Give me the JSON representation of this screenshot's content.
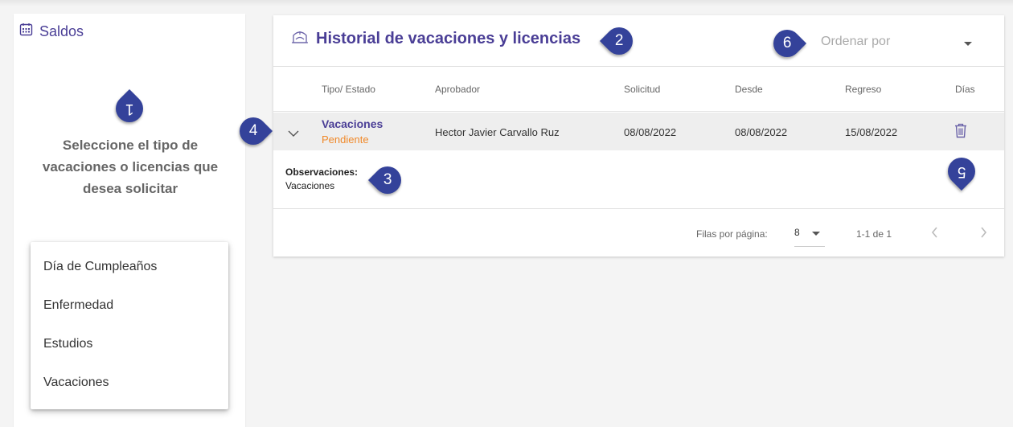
{
  "sidebar": {
    "title": "Saldos",
    "prompt": "Seleccione el tipo de vacaciones o licencias que desea solicitar",
    "menu_items": [
      "Día de Cumpleaños",
      "Enfermedad",
      "Estudios",
      "Vacaciones"
    ]
  },
  "card": {
    "title": "Historial de vacaciones y licencias",
    "sort_placeholder": "Ordenar por",
    "columns": {
      "tipo": "Tipo/ Estado",
      "aprobador": "Aprobador",
      "solicitud": "Solicitud",
      "desde": "Desde",
      "regreso": "Regreso",
      "dias": "Días"
    },
    "row": {
      "tipo": "Vacaciones",
      "estado": "Pendiente",
      "aprobador": "Hector Javier Carvallo Ruz",
      "solicitud": "08/08/2022",
      "desde": "08/08/2022",
      "regreso": "15/08/2022"
    },
    "observations": {
      "label": "Observaciones:",
      "value": "Vacaciones"
    },
    "footer": {
      "rows_per_page_label": "Filas por página:",
      "rows_per_page": "8",
      "range": "1-1 de 1"
    }
  },
  "markers": [
    "1",
    "2",
    "3",
    "4",
    "5",
    "6"
  ],
  "colors": {
    "primary": "#4a3e96",
    "marker": "#34429a",
    "pending": "#f0892a"
  },
  "icons": [
    "calendar-icon",
    "suitcase-icon",
    "chevron-down-icon",
    "trash-icon",
    "chevron-left-icon",
    "chevron-right-icon"
  ]
}
